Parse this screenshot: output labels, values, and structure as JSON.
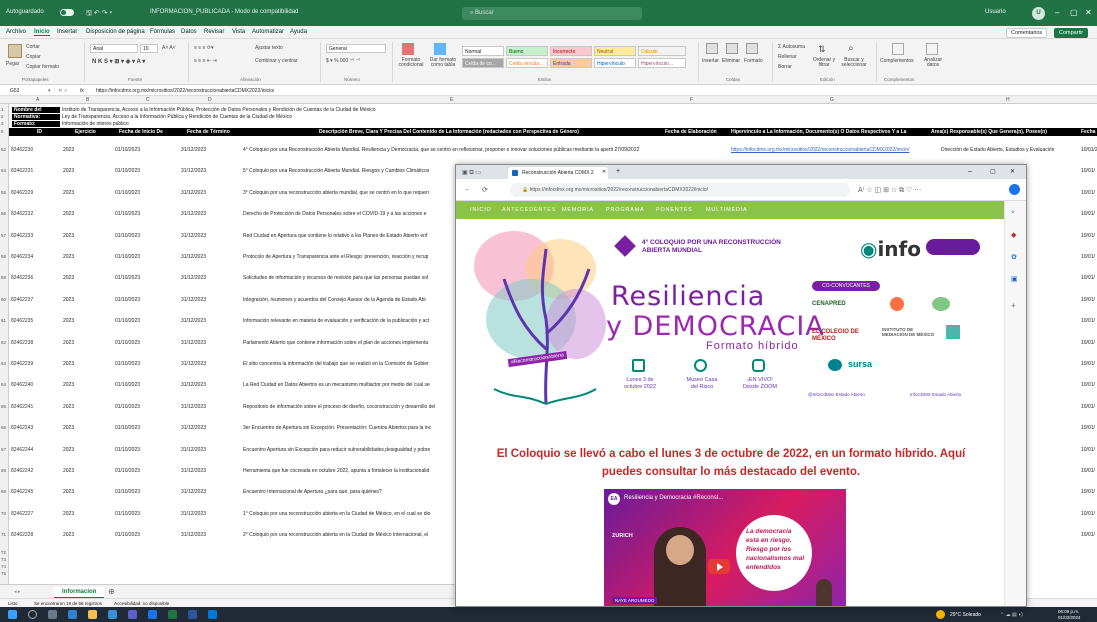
{
  "excel": {
    "title_bar": {
      "autosave": "Autoguardado",
      "filename": "INFORMACION_PUBLICADA - Modo de compatibilidad",
      "search": "Buscar",
      "user": "Usuario",
      "avatar": "U"
    },
    "menu": [
      "Archivo",
      "Inicio",
      "Insertar",
      "Disposición de página",
      "Fórmulas",
      "Datos",
      "Revisar",
      "Vista",
      "Automatizar",
      "Ayuda"
    ],
    "comments_btn": "Comentarios",
    "share_btn": "Compartir",
    "ribbon": {
      "paste": "Pegar",
      "cut": "Cortar",
      "copy": "Copiar",
      "format_painter": "Copiar formato",
      "font": "Arial",
      "font_size": "10",
      "wrap": "Ajustar texto",
      "merge": "Combinar y centrar",
      "number_format": "General",
      "cond_format": "Formato condicional",
      "table_format": "Dar formato como tabla",
      "styles": [
        "Normal",
        "Bueno",
        "Incorrecto",
        "Neutral",
        "Cálculo",
        "Celda de co...",
        "Celda vincula...",
        "Entrada",
        "Hipervínculo",
        "Hipervínculo..."
      ],
      "insert": "Insertar",
      "delete": "Eliminar",
      "format": "Formato",
      "autosum": "Autosuma",
      "fill": "Rellenar",
      "clear": "Borrar",
      "sort": "Ordenar y filtrar",
      "find": "Buscar y seleccionar",
      "addins": "Complementos",
      "analyze": "Analizar datos",
      "groups": [
        "Portapapeles",
        "Fuente",
        "Alineación",
        "Número",
        "Estilos",
        "Celdas",
        "Edición",
        "Complementos"
      ]
    },
    "formula_bar": {
      "cell_ref": "G53",
      "fx": "fx",
      "value": "https://infocdmx.org.mx/micrositios/2022/reconstruccionabiertaCDMX2022/inicio/"
    },
    "columns": [
      "A",
      "B",
      "C",
      "D",
      "E",
      "F",
      "G",
      "H"
    ],
    "meta_rows": [
      {
        "num": "1",
        "label": "Nombre del",
        "value": "Instituto de Transparencia, Acceso a la Información Pública, Protección de Datos Personales y Rendición de Cuentas de la Ciudad de México"
      },
      {
        "num": "2",
        "label": "Normativa:",
        "value": "Ley de Transparencia, Acceso a la Información Pública y Rendición de Cuentas de la Ciudad de México"
      },
      {
        "num": "3",
        "label": "Formato:",
        "value": "Información de interés público"
      }
    ],
    "header_row_num": "5",
    "headers": [
      "ID",
      "Ejercicio",
      "Fecha de Inicio De",
      "Fecha de Término",
      "Descripción Breve, Clara Y Precisa Del Contenido de La Información (redactados con Perspectiva de Género)",
      "Fecha de Elaboración",
      "Hipervínculo a La Información, Documento(s) O Datos Respectivos Y a La",
      "Área(s) Responsable(s) Que Genera(n), Posee(n)",
      "Fecha"
    ],
    "rows": [
      {
        "num": "52",
        "id": "82462230",
        "year": "2023",
        "start": "01/10/2023",
        "end": "31/12/2023",
        "desc": "4° Coloquio por una Reconstrucción Abierta Mundial. Resiliencia y Democracia, que se centró en reflexionar, proponer e innovar soluciones públicas mediante la aperti 27/09/2022",
        "link": "https://infocdmx.org.mx/micrositios/2022/reconstruccionabiertaCDMX2022/inicio/",
        "area": "Dirección de Estado Abierto, Estudios y Evaluación",
        "date": "10/01/2"
      },
      {
        "num": "54",
        "id": "82462231",
        "year": "2023",
        "start": "01/10/2023",
        "end": "31/12/2023",
        "desc": "5° Coloquio por una Reconstrucción Abierta Mundial. Riesgos y Cambios Climáticos",
        "area": "stios y Evaluación",
        "date": "10/01/"
      },
      {
        "num": "55",
        "id": "82462229",
        "year": "2023",
        "start": "01/10/2023",
        "end": "31/12/2023",
        "desc": "3° Coloquio por una reconstrucción abierta mundial, que se centró en lo que requeri",
        "area": "stios y Evaluación",
        "date": "10/01/"
      },
      {
        "num": "56",
        "id": "82462232",
        "year": "2023",
        "start": "01/10/2023",
        "end": "31/12/2023",
        "desc": "Derecho de Protección de Datos Personales sobre el COVID-19 y a las acciones e",
        "area": "stios y Evaluación",
        "date": "10/01/"
      },
      {
        "num": "57",
        "id": "82462233",
        "year": "2023",
        "start": "01/10/2023",
        "end": "31/12/2023",
        "desc": "Red Ciudad en Apertura que contiene lo relativo a los Planes de Estado Abierto enf",
        "area": "stios y Evaluación",
        "date": "10/01/"
      },
      {
        "num": "58",
        "id": "82462234",
        "year": "2023",
        "start": "01/10/2023",
        "end": "31/12/2023",
        "desc": "Protocolo de Apertura y Transparencia ante el Riesgo: prevención, reacción y recup",
        "area": "stios y Evaluación",
        "date": "10/01/"
      },
      {
        "num": "59",
        "id": "82462236",
        "year": "2023",
        "start": "01/10/2023",
        "end": "31/12/2023",
        "desc": "Solicitudes de información y recursos de revisión para que las personas puedan sol",
        "area": "stios y Evaluación",
        "date": "10/01/"
      },
      {
        "num": "60",
        "id": "82462237",
        "year": "2023",
        "start": "01/10/2023",
        "end": "31/12/2023",
        "desc": "Integración, reuniones y acuerdos del Consejo Asesor de la Agenda de Estado Abi",
        "area": "stios y Evaluación",
        "date": "10/01/"
      },
      {
        "num": "61",
        "id": "82462235",
        "year": "2023",
        "start": "01/10/2023",
        "end": "31/12/2023",
        "desc": "Información relevante en materia de evaluación y verificación de la publicación y act",
        "area": "stios y Evaluación",
        "date": "10/01/"
      },
      {
        "num": "62",
        "id": "82462238",
        "year": "2023",
        "start": "01/10/2023",
        "end": "31/12/2023",
        "desc": "Parlamento Abierto que contiene información sobre el plan de acciones implementa",
        "area": "stios y Evaluación",
        "date": "10/01/"
      },
      {
        "num": "63",
        "id": "82462239",
        "year": "2023",
        "start": "01/10/2023",
        "end": "31/12/2023",
        "desc": "El sitio concentra la información del trabajo que se realizó en la Comisión de Gobier",
        "area": "stios y Evaluación",
        "date": "10/01/"
      },
      {
        "num": "64",
        "id": "82462240",
        "year": "2023",
        "start": "01/10/2023",
        "end": "31/12/2023",
        "desc": "La Red Ciudad en Datos Abiertos es un mecanismo multiactor por medio del cual se",
        "area": "stios y Evaluación",
        "date": "10/01/"
      },
      {
        "num": "65",
        "id": "82462241",
        "year": "2023",
        "start": "01/10/2023",
        "end": "31/12/2023",
        "desc": "Repositorio de información sobre el proceso de diseño, coconstrucción y desarrollo del",
        "area": "stios y Evaluación",
        "date": "10/01/"
      },
      {
        "num": "66",
        "id": "82462243",
        "year": "2023",
        "start": "01/10/2023",
        "end": "31/12/2023",
        "desc": "3er Encuentro de Apertura sin Excepción. Presentación: Cuentos Abiertos para la inc",
        "area": "stios y Evaluación",
        "date": "10/01/"
      },
      {
        "num": "67",
        "id": "82462244",
        "year": "2023",
        "start": "01/10/2023",
        "end": "31/12/2023",
        "desc": "Encuentro Apertura sin Excepción para reducir vulnerabilidades,desigualdad y pobre",
        "area": "stios y Evaluación",
        "date": "10/01/"
      },
      {
        "num": "68",
        "id": "82462242",
        "year": "2023",
        "start": "01/10/2023",
        "end": "31/12/2023",
        "desc": "Herramienta que fue cocreada en octubre 2022, apunta a fortalecer la institucionalid",
        "area": "stios y Evaluación",
        "date": "10/01/"
      },
      {
        "num": "69",
        "id": "82462245",
        "year": "2023",
        "start": "01/10/2023",
        "end": "31/12/2023",
        "desc": "Encuentro Internacional de Apertura ¿para qué, para quiénes?",
        "area": "stios y Evaluación",
        "date": "10/01/"
      },
      {
        "num": "70",
        "id": "82462227",
        "year": "2023",
        "start": "01/10/2023",
        "end": "31/12/2023",
        "desc": "1° Coloquio por una reconstrucción abierta en la Ciudad de México, en el cual se dio",
        "area": "stios y Evaluación",
        "date": "10/01/"
      },
      {
        "num": "71",
        "id": "82462228",
        "year": "2023",
        "start": "01/10/2023",
        "end": "31/12/2023",
        "desc": "2° Coloquio por una reconstrucción abierta en la Ciudad de México Internacional, el",
        "area": "stios y Evaluación",
        "date": "10/01/"
      }
    ],
    "empty_rows": [
      "72",
      "73",
      "74",
      "75"
    ],
    "sheet_tab": "Informacion",
    "status": {
      "ready": "Listo",
      "records": "Se encontraron 19 de 66 registros",
      "accessibility": "Accesibilidad: no disponible"
    }
  },
  "browser": {
    "tab_title": "Reconstrucción Abierta CDMX 2",
    "url": "https://infocdmx.org.mx/micrositios/2022/reconstruccionabiertaCDMX2022/inicio/",
    "nav": [
      "INICIO",
      "ANTECEDENTES",
      "MEMORIA",
      "PROGRAMA",
      "PONENTES",
      "MULTIMEDIA"
    ],
    "hero": {
      "coloquio": "4° COLOQUIO POR UNA RECONSTRUCCIÓN ABIERTA MUNDIAL",
      "title1": "Resiliencia",
      "title2": "y DEMOCRACIA",
      "formato": "Formato híbrido",
      "hashtag": "#ReconstruccionAbierta",
      "info_items": [
        {
          "line1": "Lunes 3 de",
          "line2": "octubre 2022"
        },
        {
          "line1": "Museo Casa",
          "line2": "del Risco"
        },
        {
          "line1": "¡EN VIVO!",
          "line2": "Desde ZOOM"
        }
      ],
      "info_logo": "info",
      "convocantes": "CO-CONVOCANTES",
      "logos": [
        "CENAPRED",
        "EL COLEGIO DE MÉXICO",
        "INSTITUTO DE MEDIACIÓN DE MÉXICO",
        "sursa"
      ],
      "social1": "@InfoCdMex Estado Abierto",
      "social2": "InfoCDMX Estado Abierto"
    },
    "summary": "El Coloquio se llevó a cabo el lunes 3 de octubre de 2022, en un formato híbrido. Aquí puedes consultar lo más destacado del evento.",
    "video": {
      "title": "Resiliencia y Democracia #Reconst...",
      "quote": "La democracia está en riesgo. Riesgo por los nacionalismos mal entendidos",
      "speaker": "ZURICH",
      "lower_third": "NAYE ARGUMEDO"
    }
  },
  "taskbar": {
    "weather": "29°C Soleado",
    "time": "06:09 p.m.",
    "date": "01/03/2024"
  }
}
